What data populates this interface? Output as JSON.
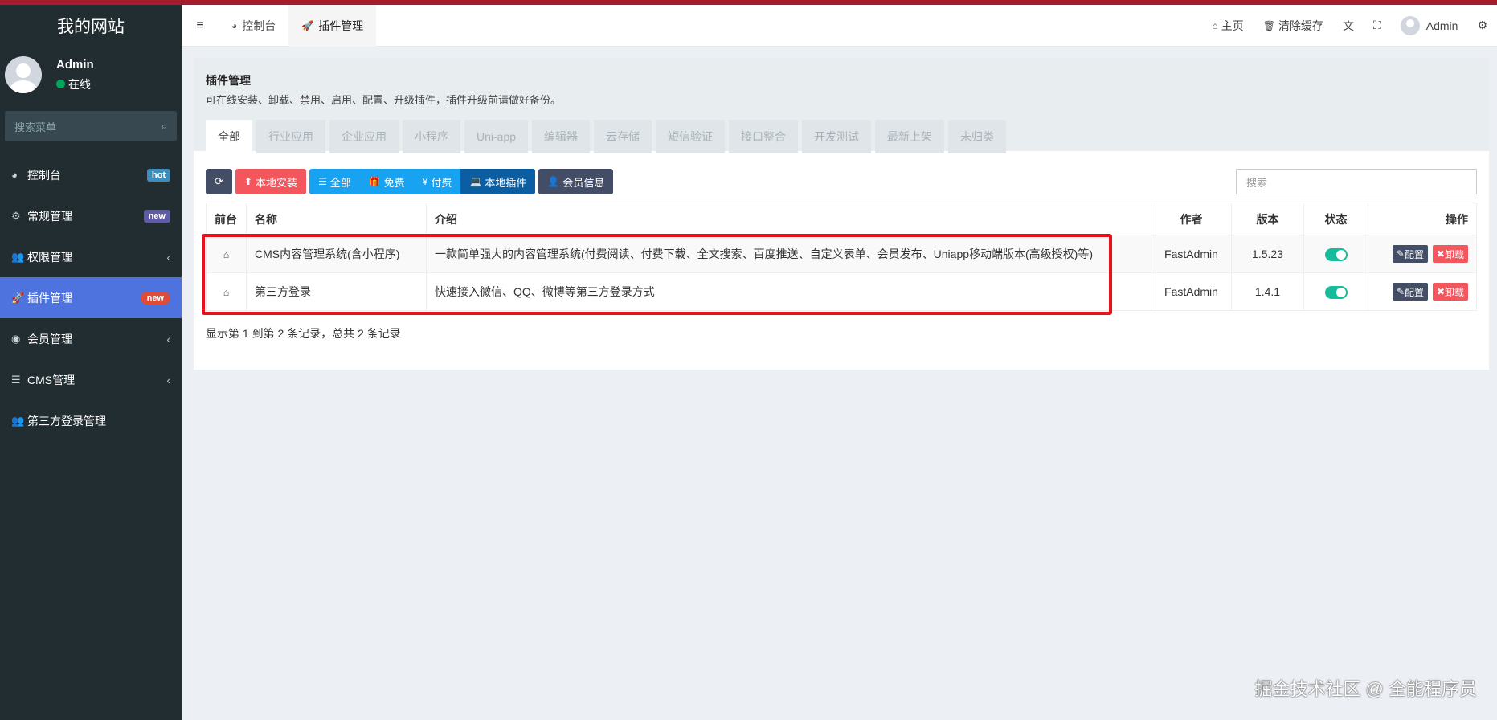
{
  "site_name": "我的网站",
  "user": {
    "name": "Admin",
    "status": "在线"
  },
  "sidebar": {
    "search_placeholder": "搜索菜单",
    "items": [
      {
        "label": "控制台",
        "icon": "dashboard-icon",
        "glyph": "◕",
        "badge": "hot"
      },
      {
        "label": "常规管理",
        "icon": "cogs-icon",
        "glyph": "⚙",
        "badge": "new"
      },
      {
        "label": "权限管理",
        "icon": "group-icon",
        "glyph": "👥",
        "chevron": "‹"
      },
      {
        "label": "插件管理",
        "icon": "rocket-icon",
        "glyph": "🚀",
        "badge": "new",
        "active": true
      },
      {
        "label": "会员管理",
        "icon": "user-circle-icon",
        "glyph": "◉",
        "chevron": "‹"
      },
      {
        "label": "CMS管理",
        "icon": "list-icon",
        "glyph": "☰",
        "chevron": "‹"
      },
      {
        "label": "第三方登录管理",
        "icon": "group-icon",
        "glyph": "👥"
      }
    ]
  },
  "header": {
    "tabs": [
      {
        "label": "控制台",
        "icon": "dashboard-icon"
      },
      {
        "label": "插件管理",
        "icon": "rocket-icon"
      }
    ],
    "right": {
      "home": "主页",
      "clear_cache": "清除缓存",
      "user": "Admin"
    }
  },
  "panel": {
    "title": "插件管理",
    "description": "可在线安装、卸载、禁用、启用、配置、升级插件，插件升级前请做好备份。",
    "categories": [
      "全部",
      "行业应用",
      "企业应用",
      "小程序",
      "Uni-app",
      "编辑器",
      "云存储",
      "短信验证",
      "接口整合",
      "开发测试",
      "最新上架",
      "未归类"
    ]
  },
  "toolbar": {
    "local_install": "本地安装",
    "all": "全部",
    "free": "免费",
    "paid": "付费",
    "local_plugins": "本地插件",
    "member_info": "会员信息",
    "search_placeholder": "搜索"
  },
  "table": {
    "headers": {
      "front": "前台",
      "name": "名称",
      "intro": "介绍",
      "author": "作者",
      "version": "版本",
      "status": "状态",
      "ops": "操作"
    },
    "rows": [
      {
        "name": "CMS内容管理系统(含小程序)",
        "intro": "一款简单强大的内容管理系统(付费阅读、付费下载、全文搜索、百度推送、自定义表单、会员发布、Uniapp移动端版本(高级授权)等)",
        "author": "FastAdmin",
        "version": "1.5.23",
        "enabled": true
      },
      {
        "name": "第三方登录",
        "intro": "快速接入微信、QQ、微博等第三方登录方式",
        "author": "FastAdmin",
        "version": "1.4.1",
        "enabled": true
      }
    ],
    "config_label": "配置",
    "uninstall_label": "卸载"
  },
  "summary": "显示第 1 到第 2 条记录，总共 2 条记录",
  "watermark": "掘金技术社区 @ 全能程序员",
  "colors": {
    "sidebar_bg": "#222d32",
    "active": "#4e73df",
    "toggle_on": "#18bc9c",
    "highlight_box": "#e8121c"
  }
}
